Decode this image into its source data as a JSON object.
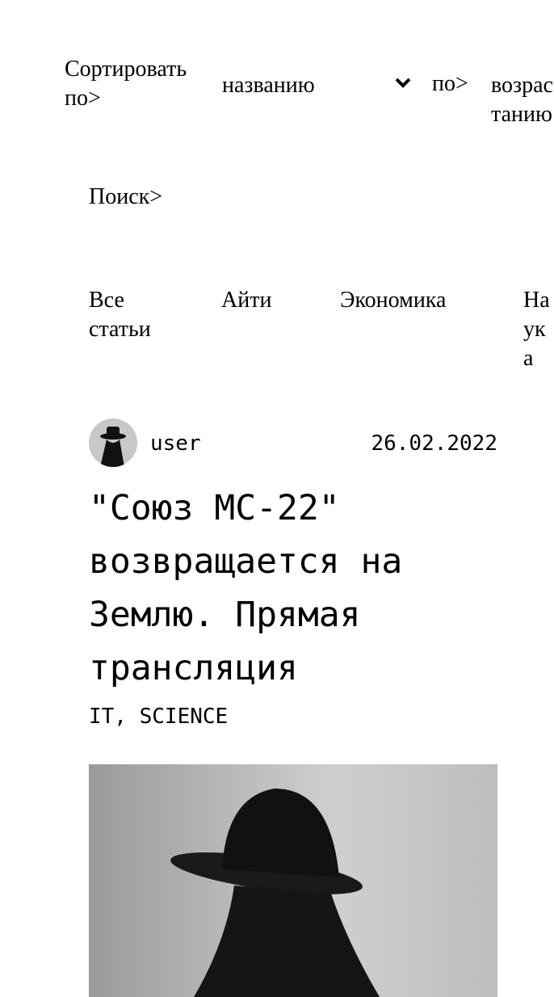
{
  "sort": {
    "label": "Сортировать по>",
    "field": "названию",
    "direction_label": "по>",
    "direction": "возрастанию"
  },
  "search": {
    "label": "Поиск>"
  },
  "categories": [
    "Все статьи",
    "Айти",
    "Экономика",
    "Наука"
  ],
  "article": {
    "author": "user",
    "date": "26.02.2022",
    "title": "\"Союз МС-22\" возвращается на Землю. Прямая трансляция",
    "tags": "IT, SCIENCE"
  }
}
